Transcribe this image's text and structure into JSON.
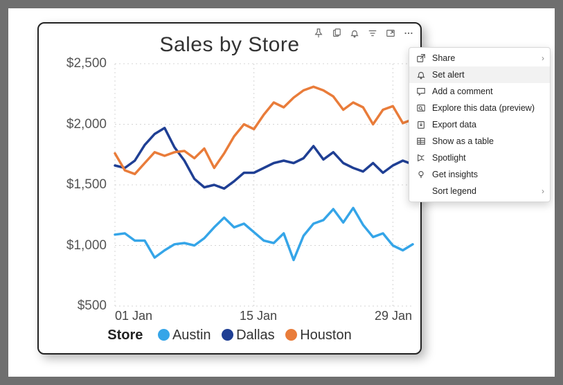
{
  "title": "Sales by Store",
  "yticks": [
    "$2,500",
    "$2,000",
    "$1,500",
    "$1,000",
    "$500"
  ],
  "xticks": [
    "01 Jan",
    "15 Jan",
    "29 Jan"
  ],
  "legend": {
    "title": "Store",
    "items": [
      "Austin",
      "Dallas",
      "Houston"
    ]
  },
  "legend_colors": {
    "Austin": "#35a5e8",
    "Dallas": "#1f3f94",
    "Houston": "#e97c3a"
  },
  "toolbar": [
    "pin",
    "copy",
    "bell",
    "filter",
    "focus",
    "more"
  ],
  "menu": {
    "items": [
      {
        "label": "Share",
        "icon": "share",
        "chevron": true
      },
      {
        "label": "Set alert",
        "icon": "bell",
        "hovered": true
      },
      {
        "label": "Add a comment",
        "icon": "comment"
      },
      {
        "label": "Explore this data (preview)",
        "icon": "explore"
      },
      {
        "label": "Export data",
        "icon": "export"
      },
      {
        "label": "Show as a table",
        "icon": "table"
      },
      {
        "label": "Spotlight",
        "icon": "spotlight"
      },
      {
        "label": "Get insights",
        "icon": "bulb"
      },
      {
        "label": "Sort legend",
        "icon": "",
        "chevron": true
      }
    ]
  },
  "chart_data": {
    "type": "line",
    "title": "Sales by Store",
    "xlabel": "",
    "ylabel": "",
    "ylim": [
      500,
      2500
    ],
    "x": [
      1,
      2,
      3,
      4,
      5,
      6,
      7,
      8,
      9,
      10,
      11,
      12,
      13,
      14,
      15,
      16,
      17,
      18,
      19,
      20,
      21,
      22,
      23,
      24,
      25,
      26,
      27,
      28,
      29,
      30,
      31
    ],
    "x_tick_labels": [
      "01 Jan",
      "15 Jan",
      "29 Jan"
    ],
    "series": [
      {
        "name": "Austin",
        "color": "#35a5e8",
        "values": [
          1090,
          1100,
          1040,
          1040,
          900,
          960,
          1010,
          1020,
          1000,
          1060,
          1150,
          1230,
          1150,
          1180,
          1110,
          1040,
          1020,
          1100,
          880,
          1080,
          1180,
          1210,
          1300,
          1190,
          1310,
          1170,
          1070,
          1100,
          1000,
          960,
          1010
        ]
      },
      {
        "name": "Dallas",
        "color": "#1f3f94",
        "values": [
          1660,
          1640,
          1700,
          1830,
          1920,
          1970,
          1810,
          1700,
          1550,
          1480,
          1500,
          1470,
          1530,
          1600,
          1600,
          1640,
          1680,
          1700,
          1680,
          1720,
          1820,
          1710,
          1770,
          1680,
          1640,
          1610,
          1680,
          1600,
          1660,
          1700,
          1670
        ]
      },
      {
        "name": "Houston",
        "color": "#e97c3a",
        "values": [
          1760,
          1620,
          1590,
          1680,
          1770,
          1740,
          1770,
          1780,
          1720,
          1800,
          1640,
          1760,
          1900,
          2000,
          1960,
          2080,
          2180,
          2140,
          2220,
          2280,
          2310,
          2280,
          2230,
          2120,
          2180,
          2140,
          2000,
          2120,
          2150,
          2010,
          2040
        ]
      }
    ]
  }
}
